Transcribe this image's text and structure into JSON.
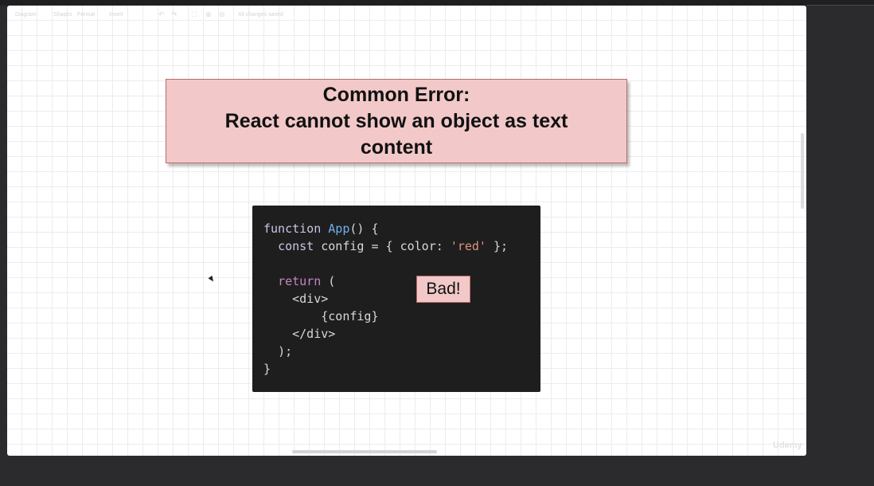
{
  "toolbar": {
    "diagram": "Diagram",
    "shapes": "Shapes",
    "format": "Format",
    "insert": "Insert",
    "saved_status": "All changes saved",
    "undo_icon": "undo-icon",
    "redo_icon": "redo-icon",
    "fullscreen_icon": "fullscreen-icon",
    "zoom_in_icon": "zoom-in-icon",
    "zoom_out_icon": "zoom-out-icon"
  },
  "slide": {
    "title_line1": "Common Error:",
    "title_line2": "React cannot show an object as text",
    "title_line3": "content",
    "badge": "Bad!"
  },
  "code": {
    "line1_kw": "function",
    "line1_fn": "App",
    "line1_rest": "() {",
    "line2_kw": "const",
    "line2_mid": " config = { color: ",
    "line2_str": "'red'",
    "line2_end": " };",
    "line4_kw": "return",
    "line4_rest": " (",
    "line5": "<div>",
    "line6": "{config}",
    "line7": "</div>",
    "line8": ");",
    "line9": "}"
  },
  "watermark": "Udemy",
  "colors": {
    "title_bg": "#f2c8c8",
    "title_border": "#b86a6a",
    "code_bg": "#1e1e1e",
    "keyword": "#c586c0",
    "function_name": "#6fb0ee",
    "string": "#e0937a"
  }
}
